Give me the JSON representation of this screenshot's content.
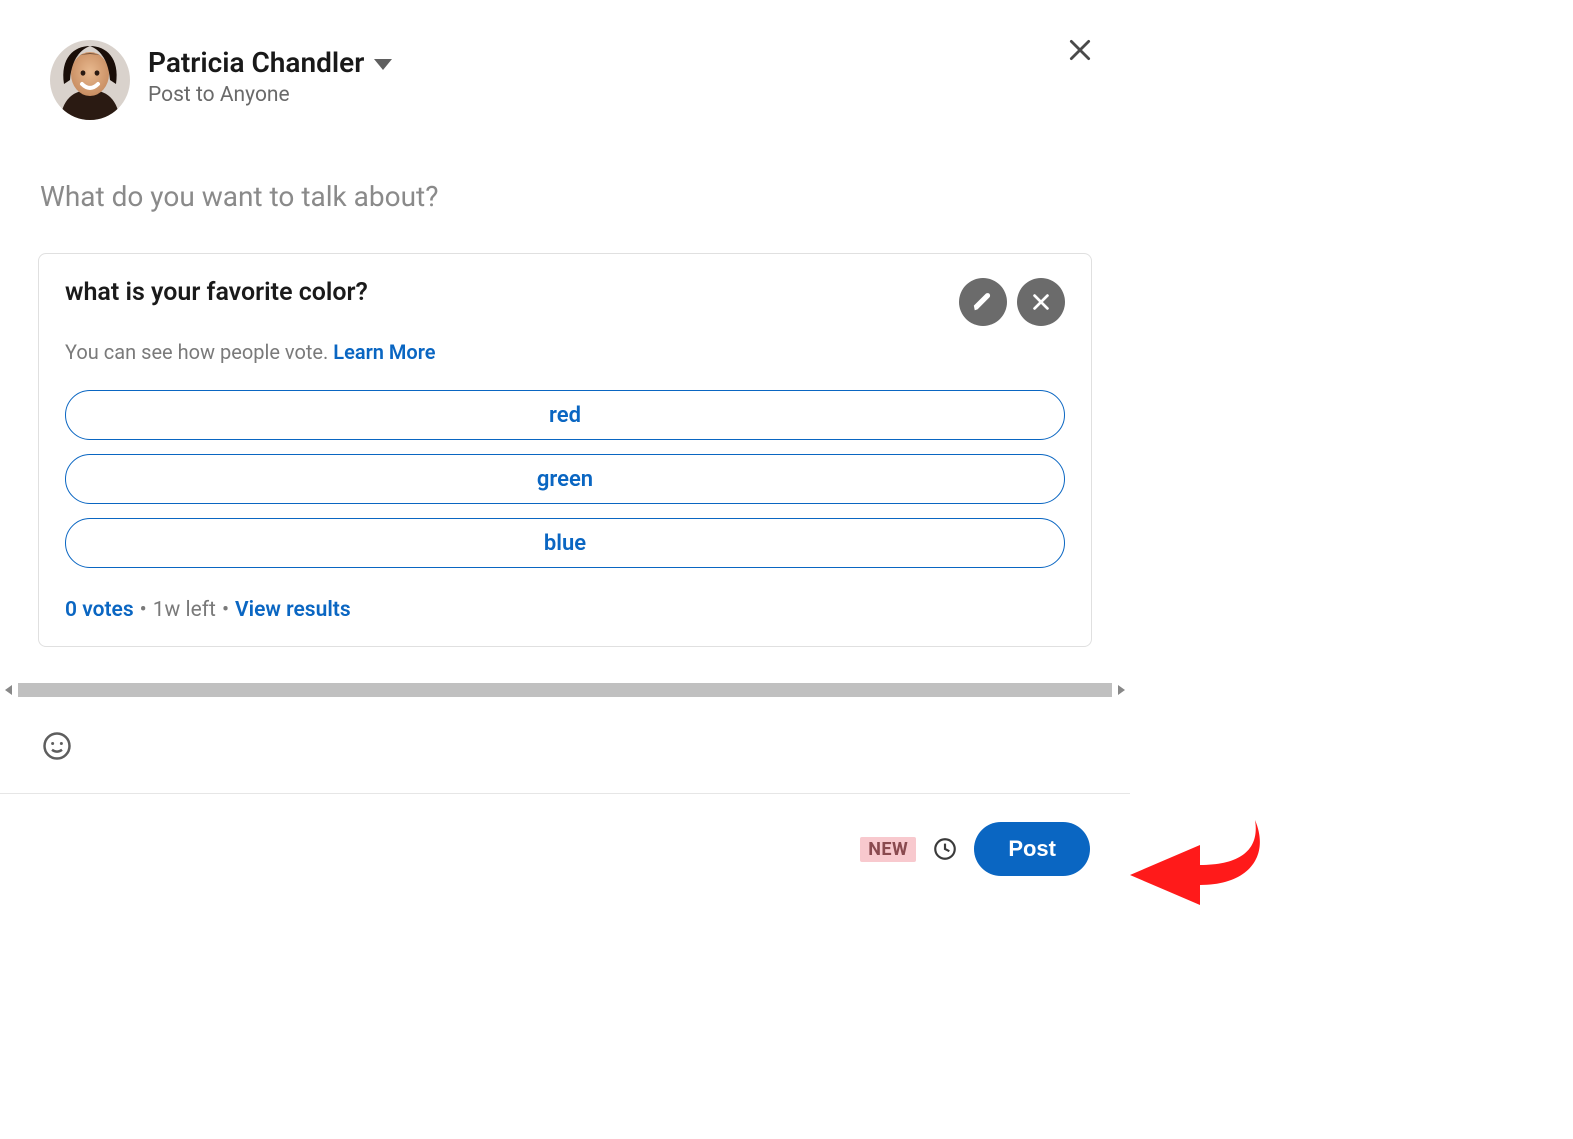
{
  "user": {
    "name": "Patricia Chandler",
    "post_to": "Post to Anyone"
  },
  "compose": {
    "placeholder_text": "What do you want to talk about?"
  },
  "poll": {
    "question": "what is your favorite color?",
    "sub_text": "You can see how people vote. ",
    "learn_more": "Learn More",
    "options": [
      "red",
      "green",
      "blue"
    ],
    "votes_label": "0 votes",
    "time_left": "1w left",
    "view_results": "View results"
  },
  "footer": {
    "new_badge": "NEW",
    "post_label": "Post"
  },
  "icons": {
    "close": "close-icon",
    "caret": "caret-down-icon",
    "edit": "pencil-icon",
    "remove": "x-icon",
    "emoji": "emoji-icon",
    "clock": "clock-icon",
    "avatar": "avatar"
  },
  "colors": {
    "primary": "#0a66c2",
    "badge_bg": "#f8c9ce",
    "annotation": "#ff1a1a"
  }
}
